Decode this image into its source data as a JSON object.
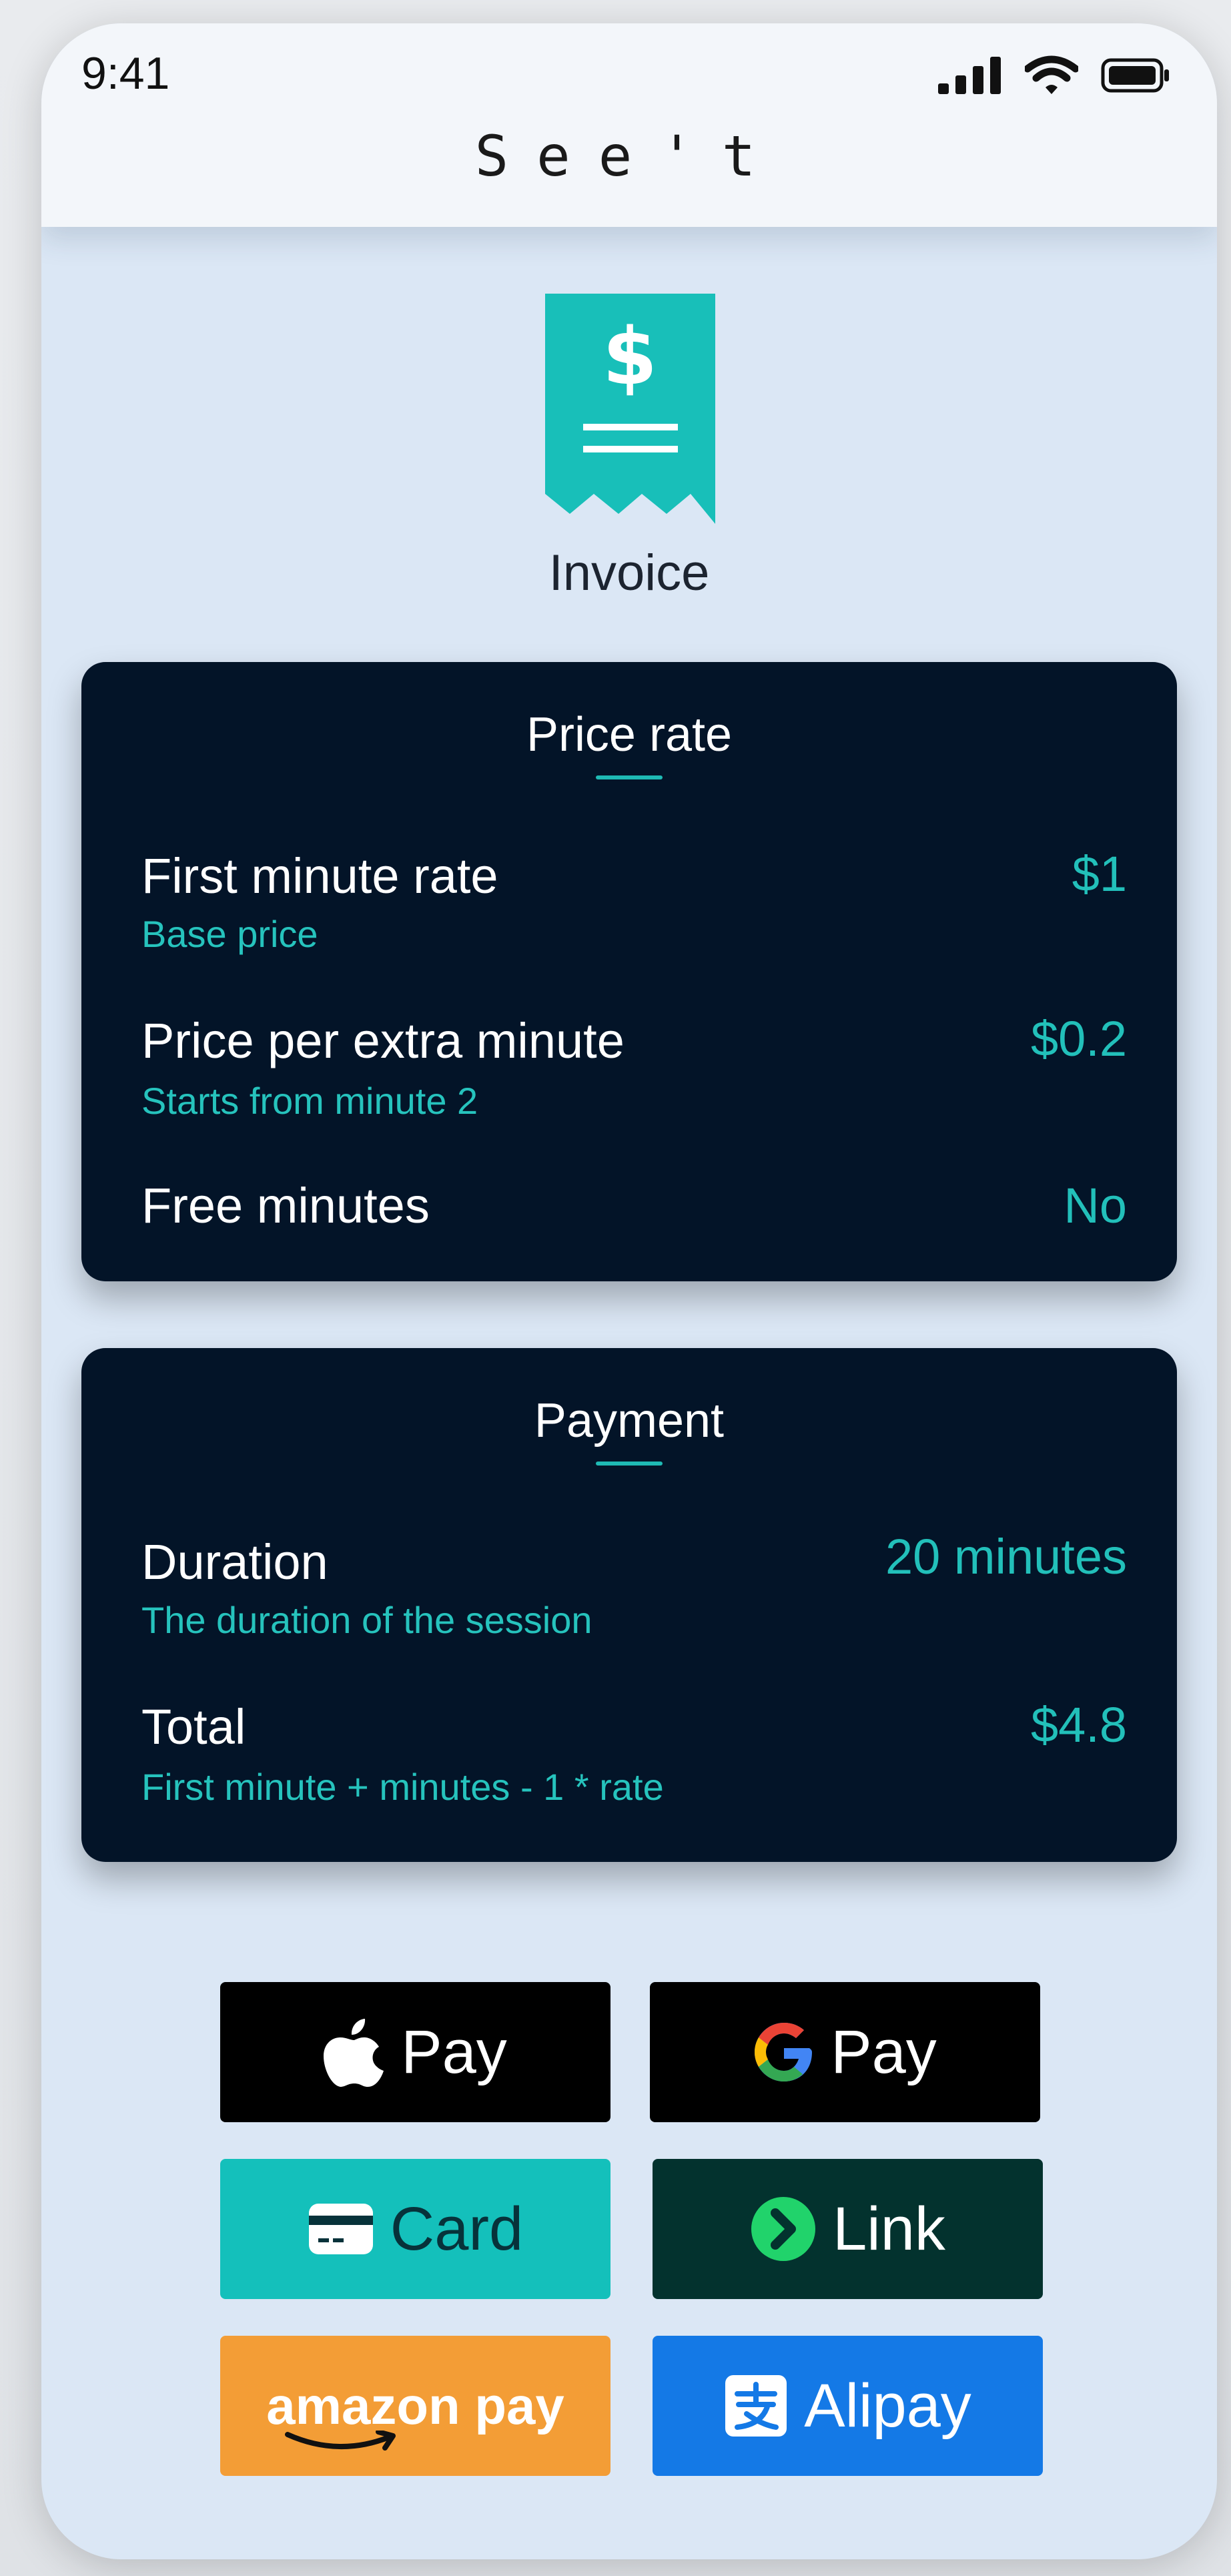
{
  "status_bar": {
    "time": "9:41"
  },
  "header": {
    "brand": "See't"
  },
  "page": {
    "title": "Invoice"
  },
  "price_rate": {
    "title": "Price rate",
    "rows": [
      {
        "label": "First minute rate",
        "sublabel": "Base price",
        "value": "$1"
      },
      {
        "label": "Price per extra minute",
        "sublabel": "Starts from minute 2",
        "value": "$0.2"
      },
      {
        "label": "Free minutes",
        "value": "No"
      }
    ]
  },
  "payment": {
    "title": "Payment",
    "rows": [
      {
        "label": "Duration",
        "sublabel": "The duration of the session",
        "value": "20 minutes"
      },
      {
        "label": "Total",
        "sublabel": "First minute + minutes - 1 * rate",
        "value": "$4.8"
      }
    ]
  },
  "payment_methods": [
    {
      "label": "Pay",
      "icon": "apple-icon"
    },
    {
      "label": "Pay",
      "icon": "google-icon"
    },
    {
      "label": "Card",
      "icon": "credit-card-icon"
    },
    {
      "label": "Link",
      "icon": "link-arrow-icon"
    },
    {
      "label": "amazon pay",
      "icon": "amazon-logo"
    },
    {
      "label": "Alipay",
      "icon": "alipay-icon"
    }
  ],
  "colors": {
    "accent": "#1fbab4",
    "card_bg": "#031428",
    "page_bg": "#dbe7f5",
    "card_button": "#14c0bb",
    "link_button": "#03322e",
    "amazon_button": "#f39d36",
    "alipay_button": "#1479e6"
  }
}
